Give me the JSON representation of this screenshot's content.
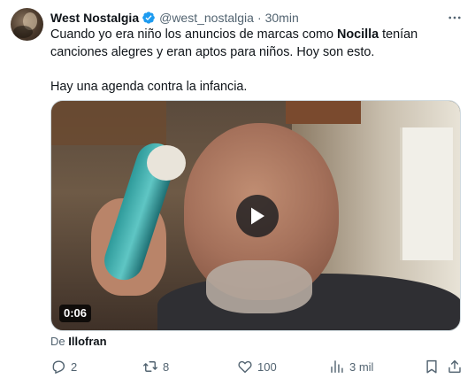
{
  "tweet": {
    "author": {
      "display_name": "West Nostalgia",
      "handle": "@west_nostalgia",
      "verified": true,
      "verified_color": "#1d9bf0"
    },
    "separator": "·",
    "time": "30min",
    "text": {
      "line_a_before": "Cuando yo era niño los anuncios de marcas como ",
      "line_a_bold": "Nocilla",
      "line_a_after": " tenían canciones alegres y eran aptos para niños. Hoy son esto.",
      "paragraph_2": "Hay una agenda contra la infancia."
    },
    "media": {
      "type": "video",
      "duration": "0:06"
    },
    "source": {
      "prefix": "De",
      "name": "Illofran"
    },
    "actions": {
      "replies": "2",
      "retweets": "8",
      "likes": "100",
      "views": "3 mil"
    }
  },
  "icons": {
    "more": "more-icon",
    "reply": "reply-icon",
    "retweet": "retweet-icon",
    "like": "heart-icon",
    "views": "views-icon",
    "bookmark": "bookmark-icon",
    "share": "share-icon",
    "play": "play-icon"
  },
  "colors": {
    "text": "#0f1419",
    "secondary": "#536471",
    "accent": "#1d9bf0"
  }
}
